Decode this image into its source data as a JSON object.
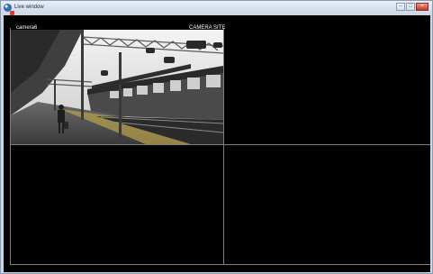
{
  "window": {
    "title": "Live window"
  },
  "camera_pane": {
    "camera_name": "camera6",
    "site_name": "CAMERA SITE"
  },
  "icons": {
    "app": "camera-app-icon",
    "recording": "recording-indicator-icon",
    "minimize": "minimize-icon",
    "maximize": "maximize-icon",
    "close": "close-icon"
  },
  "colors": {
    "background": "#000000",
    "divider": "#7f7f7f",
    "recording_indicator": "#e23b2c",
    "close_button": "#c6392a"
  }
}
